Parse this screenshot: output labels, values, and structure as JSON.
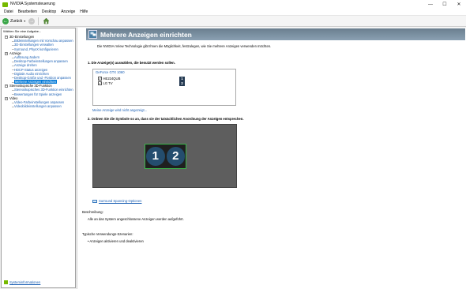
{
  "window": {
    "title": "NVIDIA Systemsteuerung",
    "min_glyph": "—",
    "max_glyph": "☐",
    "close_glyph": "✕"
  },
  "menubar": {
    "items": [
      "Datei",
      "Bearbeiten",
      "Desktop",
      "Anzeige",
      "Hilfe"
    ]
  },
  "toolbar": {
    "back_label": "Zurück",
    "back_icon": "arrow-left-icon",
    "forward_icon": "arrow-right-icon",
    "home_icon": "home-icon"
  },
  "leftpane": {
    "header": "Wählen Sie eine Aufgabe...",
    "tree": [
      {
        "type": "category",
        "label": "3D-Einstellungen"
      },
      {
        "type": "leaf",
        "label": "Bildeinstellungen mit Vorschau anpassen"
      },
      {
        "type": "leaf",
        "label": "3D-Einstellungen verwalten"
      },
      {
        "type": "leaf",
        "label": "Surround, PhysX konfigurieren"
      },
      {
        "type": "category",
        "label": "Anzeige"
      },
      {
        "type": "leaf",
        "label": "Auflösung ändern"
      },
      {
        "type": "leaf",
        "label": "Desktop-Farbeinstellungen anpassen"
      },
      {
        "type": "leaf",
        "label": "Anzeige drehen"
      },
      {
        "type": "leaf",
        "label": "HDCP-Status anzeigen"
      },
      {
        "type": "leaf",
        "label": "Digitale Audio einrichten"
      },
      {
        "type": "leaf",
        "label": "Desktop-Größe und -Position anpassen"
      },
      {
        "type": "leaf",
        "label": "Mehrere Anzeigen einrichten",
        "selected": true
      },
      {
        "type": "category",
        "label": "Stereoskopische 3D-Funktion"
      },
      {
        "type": "leaf",
        "label": "Stereoskopisches 3D-Funktion einrichten"
      },
      {
        "type": "leaf",
        "label": "Bewertungen für Spiele anzeigen"
      },
      {
        "type": "category",
        "label": "Video"
      },
      {
        "type": "leaf",
        "label": "Video-Farbeinstellungen anpassen"
      },
      {
        "type": "leaf",
        "label": "Videobildeinstellungen anpassen"
      }
    ],
    "sysinfo_link": "Systeminformationen"
  },
  "content": {
    "page_title": "Mehrere Anzeigen einrichten",
    "description": "Die NVIDIA nView Technologie gibt Ihnen die Möglichkeit, festzulegen, wie Sie mehrere Anzeigen verwenden möchten.",
    "step1_label": "1. Die Anzeige(n) auswählen, die benutzt werden sollen.",
    "gpu_name": "GeForce GTX 1060",
    "displays": [
      {
        "name": "HE224QUB",
        "checked": true,
        "number": "1"
      },
      {
        "name": "LG TV",
        "checked": true,
        "number": "2"
      }
    ],
    "check_glyph": "✓",
    "missing_display_link": "Meine Anzeige wird nicht angezeigt...",
    "step2_label": "2. Ordnen Sie die Symbole so an, dass sie der tatsächlichen Anordnung der Anzeigen entsprechen.",
    "monitors": [
      "1",
      "2"
    ],
    "surround_link": "Surround Spanning-Optionen",
    "description_label": "Beschreibung:",
    "description_text": "Alle an das System angeschlossene Anzeigen werden aufgeführt.",
    "usage_label": "Typische Verwendungs-Szenarien:",
    "usage_items": [
      "Anzeigen aktivieren und deaktivieren"
    ],
    "bullet": "•"
  },
  "colors": {
    "nvidia_green": "#76b900",
    "selection_blue": "#0078d7",
    "link_blue": "#1a5fb4",
    "arrangement_bg": "#5a5a5a",
    "monitor_border": "#3bb54a"
  }
}
